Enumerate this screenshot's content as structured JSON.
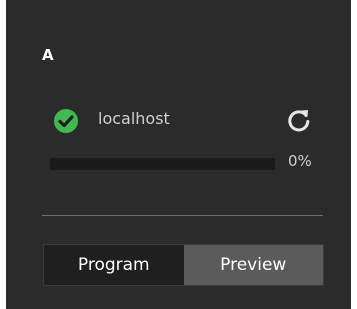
{
  "panel": {
    "title": "A"
  },
  "host": {
    "name": "localhost",
    "status": "connected",
    "status_icon": "check-circle-icon",
    "status_color": "#3fb950",
    "refresh_icon": "refresh-icon"
  },
  "progress": {
    "value": 0,
    "label": "0%"
  },
  "tabs": [
    {
      "label": "Program",
      "selected": true
    },
    {
      "label": "Preview",
      "selected": false
    }
  ],
  "colors": {
    "panel_background": "#2b2b2b",
    "progress_track": "#1a1a1a",
    "tab_selected": "#1f1f1f",
    "tab_unselected": "#5b5b5b"
  }
}
